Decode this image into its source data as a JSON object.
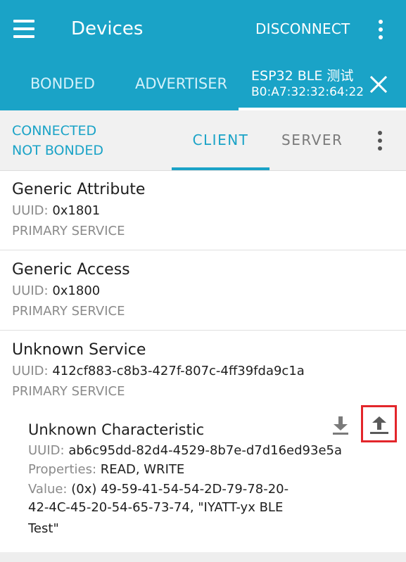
{
  "appbar": {
    "title": "Devices",
    "disconnect_label": "DISCONNECT",
    "tabs": [
      {
        "label": "BONDED"
      },
      {
        "label": "ADVERTISER"
      }
    ],
    "device_tab": {
      "name": "ESP32 BLE 测试",
      "address": "B0:A7:32:32:64:22"
    }
  },
  "connection": {
    "state": "CONNECTED",
    "bond_state": "NOT BONDED",
    "tabs": [
      {
        "label": "CLIENT"
      },
      {
        "label": "SERVER"
      }
    ]
  },
  "uuid_label": "UUID: ",
  "services": [
    {
      "name": "Generic Attribute",
      "uuid": "0x1801",
      "type": "PRIMARY SERVICE"
    },
    {
      "name": "Generic Access",
      "uuid": "0x1800",
      "type": "PRIMARY SERVICE"
    },
    {
      "name": "Unknown Service",
      "uuid": "412cf883-c8b3-427f-807c-4ff39fda9c1a",
      "type": "PRIMARY SERVICE"
    }
  ],
  "characteristic": {
    "name": "Unknown Characteristic",
    "uuid": "ab6c95dd-82d4-4529-8b7e-d7d16ed93e5a",
    "properties_label": "Properties: ",
    "properties": "READ, WRITE",
    "value_label": "Value: ",
    "value_line1": "(0x) 49-59-41-54-54-2D-79-78-20-",
    "value_line2": "42-4C-45-20-54-65-73-74, \"IYATT-yx BLE",
    "value_line3": "Test\""
  },
  "icons": {
    "menu": "hamburger-menu-icon",
    "overflow": "more-vert-icon",
    "close": "close-icon",
    "read": "download-icon",
    "write": "upload-icon"
  },
  "colors": {
    "primary": "#1aa3c7",
    "highlight": "#e3262b"
  }
}
